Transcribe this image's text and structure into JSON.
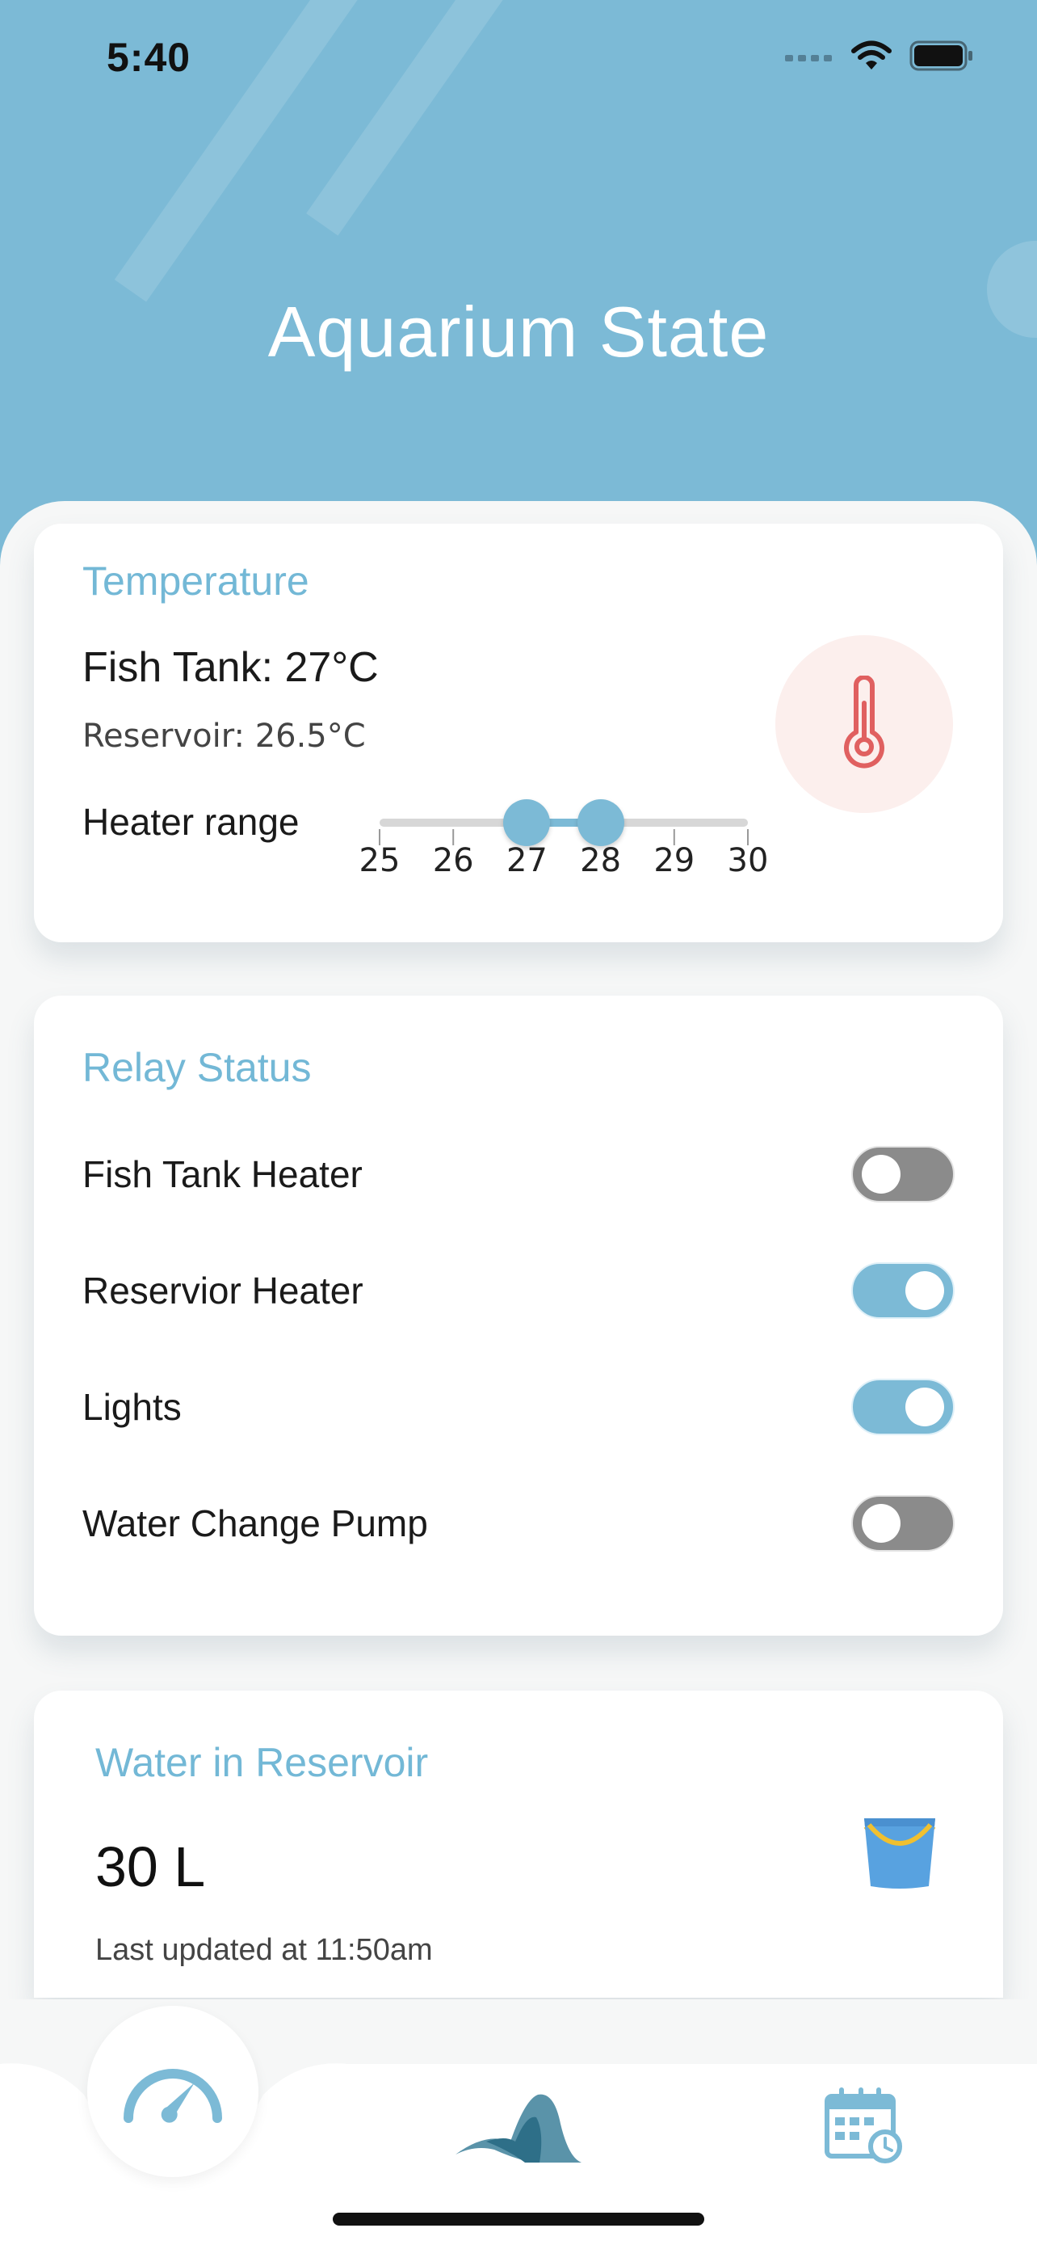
{
  "status_bar": {
    "time": "5:40"
  },
  "header": {
    "title": "Aquarium State"
  },
  "temperature": {
    "title": "Temperature",
    "fish_tank": "Fish Tank: 27°C",
    "reservoir": "Reservoir: 26.5°C",
    "heater_label": "Heater range",
    "ticks": [
      "25",
      "26",
      "27",
      "28",
      "29",
      "30"
    ],
    "range_low": 27,
    "range_high": 28,
    "scale_min": 25,
    "scale_max": 30,
    "icon": "thermometer-icon"
  },
  "relay": {
    "title": "Relay Status",
    "items": [
      {
        "label": "Fish Tank Heater",
        "on": false
      },
      {
        "label": "Reservior Heater",
        "on": true
      },
      {
        "label": "Lights",
        "on": true
      },
      {
        "label": "Water Change Pump",
        "on": false
      }
    ]
  },
  "water": {
    "title": "Water in Reservoir",
    "value": "30 L",
    "updated": "Last updated at 11:50am",
    "icon": "bucket-icon"
  },
  "tabs": [
    {
      "name": "dashboard",
      "icon": "speedometer-icon",
      "active": true
    },
    {
      "name": "aquarium",
      "icon": "wave-icon",
      "active": false
    },
    {
      "name": "schedule",
      "icon": "calendar-clock-icon",
      "active": false
    }
  ],
  "colors": {
    "accent": "#7cbad6",
    "toggle_off": "#8b8b8b",
    "thermo_red": "#e06060",
    "bucket_blue": "#58a2e0",
    "bucket_handle": "#f0c030"
  }
}
